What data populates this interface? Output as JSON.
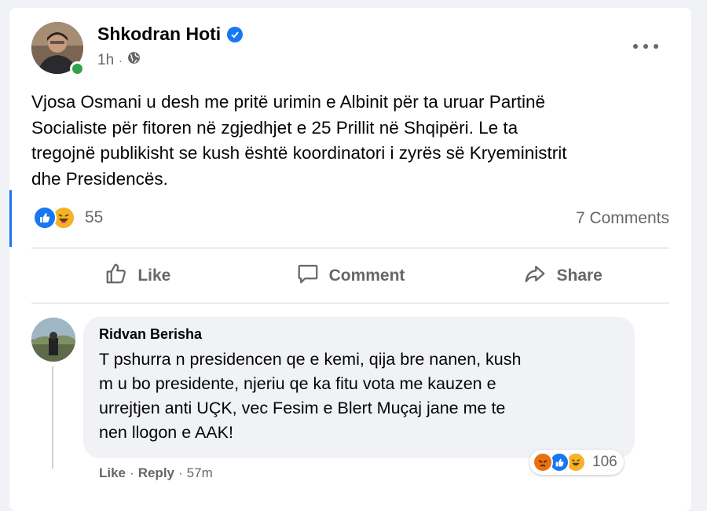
{
  "post": {
    "author": "Shkodran Hoti",
    "verified": true,
    "time": "1h",
    "audience_icon": "globe-icon",
    "text_lines": [
      "Vjosa Osmani u desh me pritë urimin e Albinit për ta uruar Partinë",
      "Socialiste për fitoren në zgjedhjet e 25 Prillit në Shqipëri. Le ta",
      "tregojnë publikisht se kush është koordinatori i zyrës së Kryeministrit",
      "dhe Presidencës."
    ],
    "reactions": {
      "icons": [
        "like-icon",
        "haha-icon"
      ],
      "count": "55"
    },
    "comments_count": "7 Comments"
  },
  "actions": {
    "like": "Like",
    "comment": "Comment",
    "share": "Share"
  },
  "comment": {
    "author": "Ridvan Berisha",
    "text_lines": [
      "T pshurra n presidencen qe e kemi, qija bre nanen, kush",
      "m u bo presidente, njeriu qe ka fitu vota me kauzen e",
      "urrejtjen anti UÇK, vec Fesim e Blert Muçaj jane me te",
      "nen llogon e AAK!"
    ],
    "reactions": {
      "icons": [
        "angry-icon",
        "like-icon",
        "haha-icon"
      ],
      "count": "106"
    },
    "like_label": "Like",
    "reply_label": "Reply",
    "separator": "·",
    "time": "57m"
  },
  "colors": {
    "accent": "#1877f2",
    "online": "#31a24c",
    "secondary_text": "#65676b",
    "background": "#f0f2f5"
  }
}
